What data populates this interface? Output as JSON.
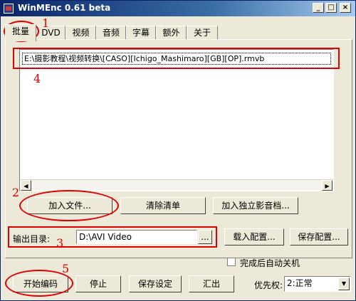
{
  "window": {
    "title": "WinMEnc 0.61 beta"
  },
  "titlebar_buttons": {
    "min": "_",
    "max": "□",
    "close": "×"
  },
  "tabs": [
    "批量",
    "DVD",
    "视频",
    "音频",
    "字幕",
    "额外",
    "关于"
  ],
  "file_list": {
    "items": [
      "E:\\摄影教程\\视频转换\\[CASO][Ichigo_Mashimaro][GB][OP].rmvb"
    ]
  },
  "scroll_arrows": {
    "left": "◀",
    "right": "▶"
  },
  "buttons": {
    "add_file": "加入文件...",
    "clear_list": "清除清单",
    "add_separate_av": "加入独立影音档...",
    "browse": "...",
    "load_config": "载入配置...",
    "save_config": "保存配置...",
    "start_encode": "开始编码",
    "stop": "停止",
    "save_settings": "保存设定",
    "export": "汇出"
  },
  "output": {
    "label": "输出目录:",
    "value": "D:\\AVI Video"
  },
  "shutdown_checkbox": {
    "label": "完成后自动关机",
    "checked": false
  },
  "priority": {
    "label": "优先权:",
    "selected": "2:正常",
    "arrow": "▼"
  },
  "annotations": [
    "1",
    "2",
    "3",
    "4",
    "5"
  ],
  "colors": {
    "annotation": "#e00000",
    "title_bar": "#0a246a"
  }
}
